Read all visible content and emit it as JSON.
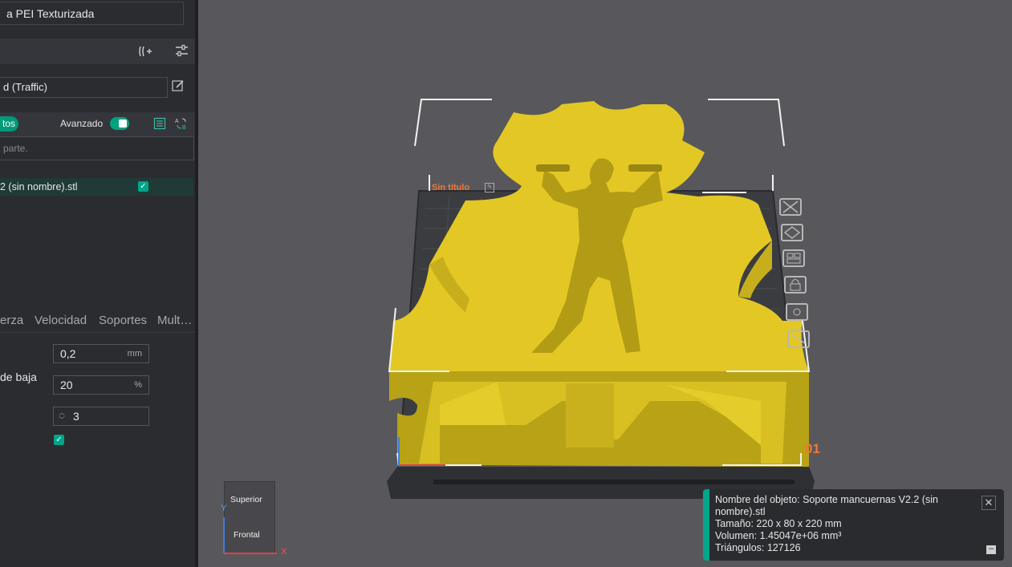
{
  "sidebar": {
    "plate_type": "a PEI Texturizada",
    "filament_profile": "d (Traffic)",
    "objects_tab_label": "tos",
    "advanced_label": "Avanzado",
    "advanced_on": true,
    "search_placeholder": "parte.",
    "object_name": "2 (sin nombre).stl",
    "tabs": [
      "erza",
      "Velocidad",
      "Soportes",
      "Mult…"
    ],
    "params": {
      "layer_height_value": "0,2",
      "layer_height_unit": "mm",
      "label_2": "de baja",
      "infill_value": "20",
      "infill_unit": "%",
      "walls_value": "3"
    }
  },
  "viewport": {
    "plate_name": "Sin título",
    "plate_number": "01",
    "gizmo": {
      "top": "Superior",
      "front": "Frontal",
      "axis_y": "Y",
      "axis_x": "X"
    },
    "colors": {
      "model": "#e3c825",
      "plate": "#2e2f33",
      "accent": "#f07836"
    }
  },
  "info": {
    "name_line1": "Nombre del objeto: Soporte mancuernas V2.2 (sin",
    "name_line2": "nombre).stl",
    "size": "Tamaño: 220 x 80 x 220 mm",
    "volume": "Volumen: 1.45047e+06 mm³",
    "triangles": "Triángulos: 127126"
  },
  "icons": {
    "arrange": "add-plate-icon",
    "settings": "sliders-icon",
    "edit": "pencil-icon",
    "list": "list-icon",
    "compare": "ab-compare-icon",
    "close": "close-icon",
    "minimize": "minimize-icon"
  }
}
